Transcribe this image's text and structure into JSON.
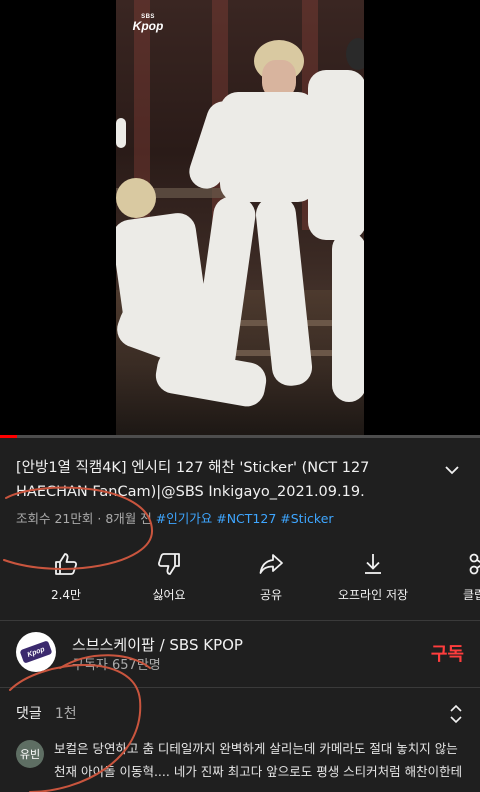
{
  "player": {
    "logo_top": "SBS",
    "logo_bottom": "Kpop",
    "progress_fraction": 0.035
  },
  "video": {
    "title": "[안방1열 직캠4K] 엔시티 127 해찬 'Sticker' (NCT 127 HAECHAN FanCam)|@SBS Inkigayo_2021.09.19.",
    "views": "조회수 21만회",
    "separator": "·",
    "age": "8개월 전",
    "hashtags": [
      "#인기가요",
      "#NCT127",
      "#Sticker"
    ]
  },
  "actions": {
    "like": "2.4만",
    "dislike": "싫어요",
    "share": "공유",
    "download": "오프라인 저장",
    "clip": "클립"
  },
  "channel": {
    "name": "스브스케이팝 / SBS KPOP",
    "subscribers": "구독자 657만명",
    "subscribe_label": "구독",
    "avatar_text": "Kpop"
  },
  "comments": {
    "label": "댓글",
    "count": "1천",
    "top": {
      "author_initial": "유빈",
      "text": "보컬은 당연하고 춤 디테일까지 완벽하게 살리는데 카메라도 절대 놓치지 않는 천재 아이돌 이동혁.... 네가 진짜 최고다 앞으로도 평생 스티커처럼 해찬이한테 꼭..."
    }
  },
  "colors": {
    "background": "#1f1f1f",
    "accent_red": "#ff0000",
    "hashtag_blue": "#3ea6ff",
    "subscribe_red": "#ff3d3d",
    "annotation_red": "#c9553e"
  }
}
